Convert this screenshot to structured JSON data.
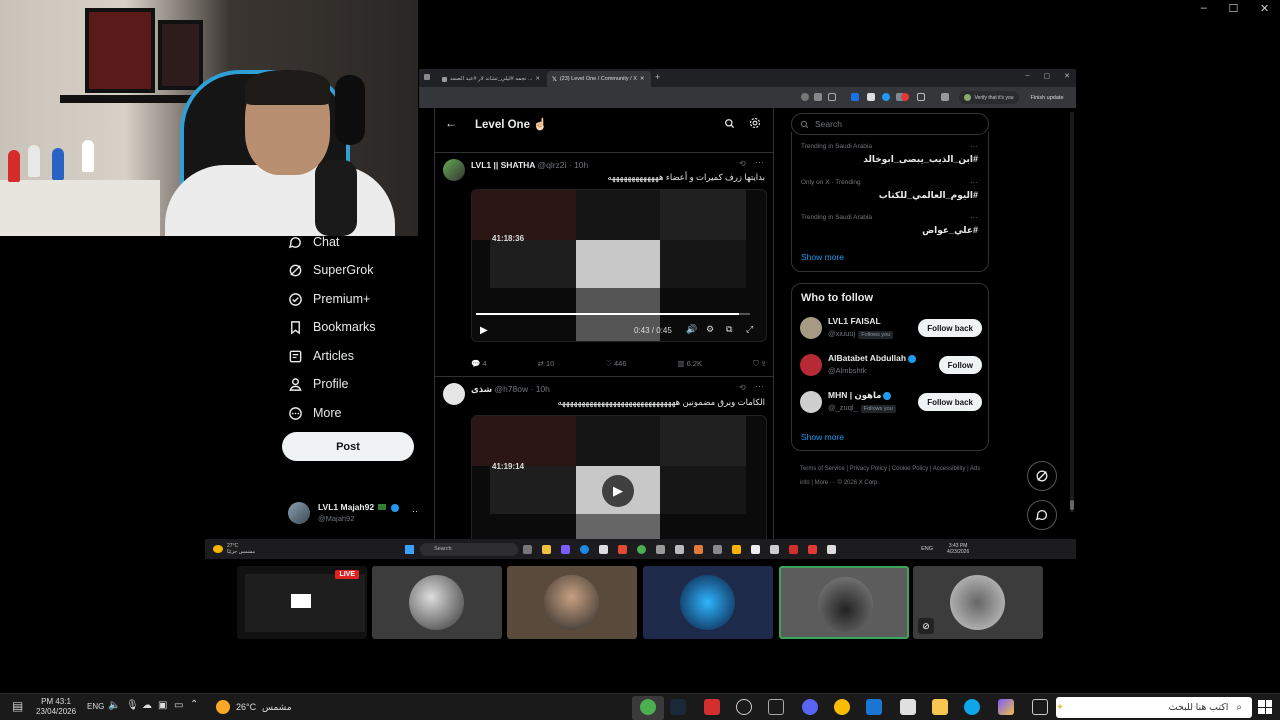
{
  "outer_window": {
    "minimize": "–",
    "maximize": "☐",
    "close": "✕"
  },
  "sidebar_nav": {
    "items": [
      {
        "label": "Chat",
        "icon": "chat-icon"
      },
      {
        "label": "SuperGrok",
        "icon": "grok-icon"
      },
      {
        "label": "Premium+",
        "icon": "premium-icon"
      },
      {
        "label": "Bookmarks",
        "icon": "bookmark-icon"
      },
      {
        "label": "Articles",
        "icon": "articles-icon"
      },
      {
        "label": "Profile",
        "icon": "profile-icon"
      },
      {
        "label": "More",
        "icon": "more-icon"
      }
    ],
    "post_label": "Post",
    "account": {
      "name": "LVL1 Majah92",
      "handle": "@Majah92",
      "more": "···"
    }
  },
  "browser": {
    "tabs": [
      {
        "label": "نجمه #ليلي_تشاند لار #عبد الصمد ..."
      },
      {
        "label": "(23) Level One / Community / X"
      }
    ],
    "new_tab": "+",
    "verify_label": "Verify that it's you",
    "finish_update": "Finish update",
    "win_min": "–",
    "win_max": "▢",
    "win_close": "✕"
  },
  "timeline": {
    "title": "Level One ☝🏻",
    "tweets": [
      {
        "author": "LVL1 || SHATHA",
        "handle": "@qlrz2i",
        "time": "· 10h",
        "text": "بدايتها زرف كميرات و أعضاء هههههههههههههه",
        "video_timestamp": "41:18:36",
        "video_time": "0:43 / 0:45",
        "replies": "4",
        "reposts": "10",
        "likes": "446",
        "views": "6.2K"
      },
      {
        "author": "شذى",
        "handle": "@h78ow",
        "time": "· 10h",
        "text": "الكامات وبرق مضمونين ههههههههههههههههههههههههههههههه",
        "video_timestamp": "41:19:14"
      }
    ]
  },
  "right_column": {
    "search_placeholder": "Search",
    "trends": [
      {
        "category": "Trending in Saudi Arabia",
        "name": "#ابن_الذيب_يبصى_ابوخالد"
      },
      {
        "category": "Only on X · Trending",
        "name": "#اليوم_العالمي_للكتاب"
      },
      {
        "category": "Trending in Saudi Arabia",
        "name": "#علي_عواض"
      }
    ],
    "show_more": "Show more",
    "who_to_follow_title": "Who to follow",
    "follow_suggestions": [
      {
        "name": "LVL1 FAISAL",
        "handle": "@xiuuuj",
        "follows_you": "Follows you",
        "button": "Follow back"
      },
      {
        "name": "AlBatabet Abdullah",
        "handle": "@Almbshtk",
        "follows_you": "",
        "button": "Follow"
      },
      {
        "name": "MHN | ماهون",
        "handle": "@_zuql_",
        "follows_you": "Follows you",
        "button": "Follow back"
      }
    ],
    "show_more_2": "Show more",
    "footer": [
      "Terms of Service",
      "Privacy Policy",
      "Cookie Policy",
      "Accessibility",
      "Ads info",
      "More ···",
      "© 2026 X Corp."
    ]
  },
  "inner_taskbar": {
    "weather": "27°C",
    "weather_sub": "مشمس جزئيًا",
    "search_label": "Search",
    "lang": "ENG",
    "clock": "3:43 PM",
    "date": "4/23/2026"
  },
  "participants": {
    "live_badge": "LIVE"
  },
  "taskbar": {
    "clock": "PM 43:1",
    "date": "23/04/2026",
    "lang": "ENG",
    "weather_temp": "26°C",
    "weather_text": "مشمس",
    "search_placeholder": "اكتب هنا للبحث"
  }
}
